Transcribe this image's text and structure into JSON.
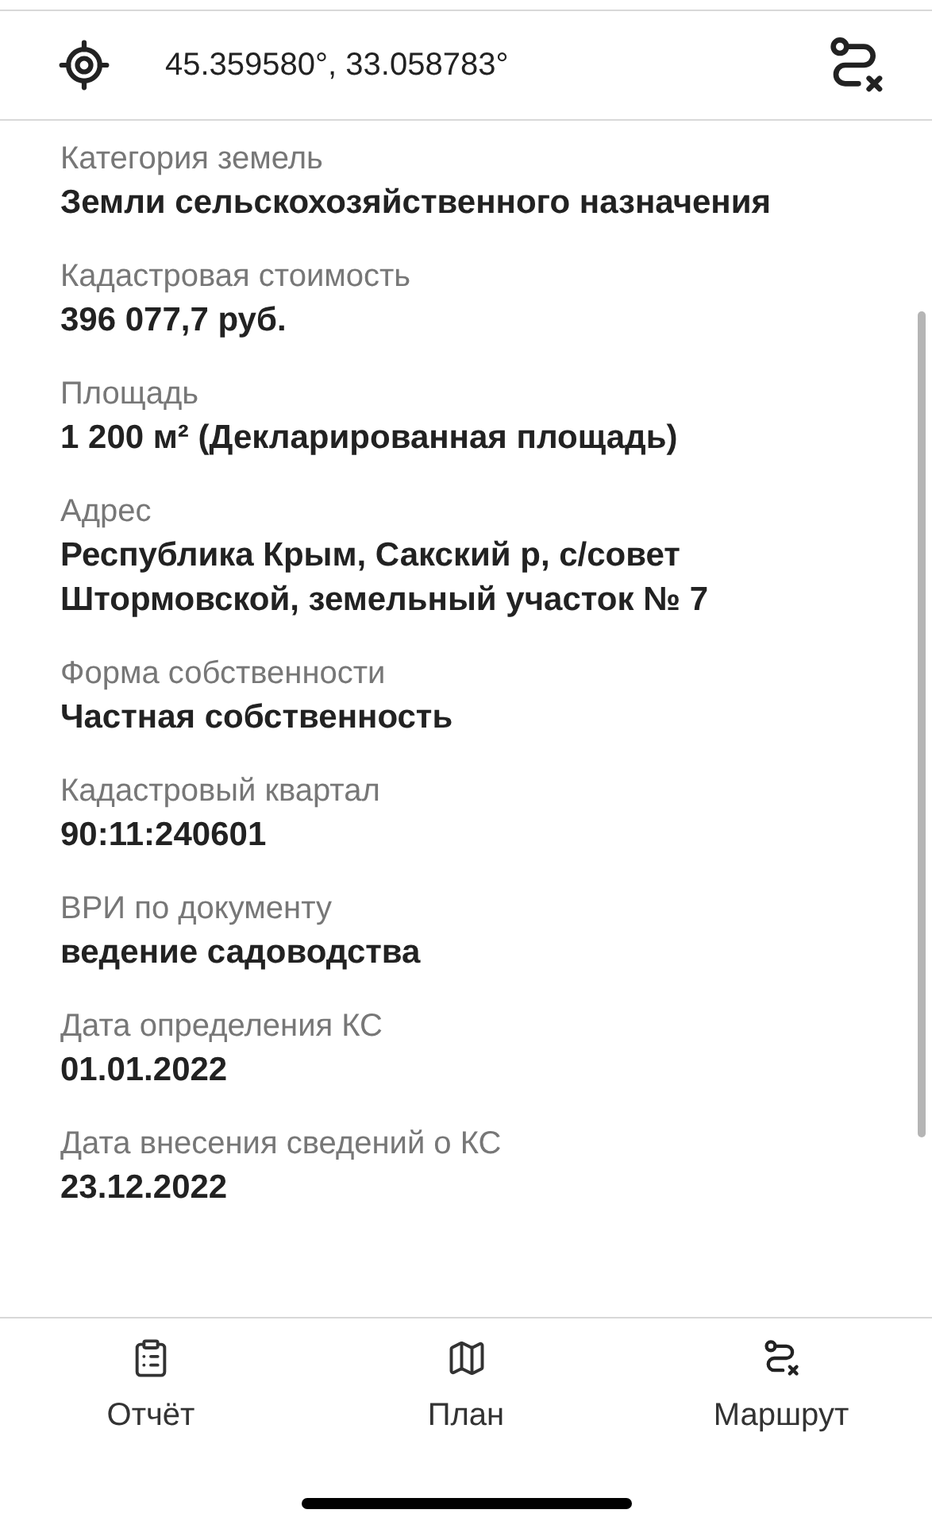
{
  "header": {
    "coordinates": "45.359580°, 33.058783°"
  },
  "fields": [
    {
      "label": "Категория земель",
      "value": "Земли сельскохозяйственного назначения"
    },
    {
      "label": "Кадастровая стоимость",
      "value": "396 077,7 руб."
    },
    {
      "label": "Площадь",
      "value": "1 200 м² (Декларированная площадь)"
    },
    {
      "label": "Адрес",
      "value": "Республика Крым, Сакский р, с/совет Штормовской, земельный участок № 7"
    },
    {
      "label": "Форма собственности",
      "value": "Частная собственность"
    },
    {
      "label": "Кадастровый квартал",
      "value": "90:11:240601"
    },
    {
      "label": "ВРИ по документу",
      "value": "ведение садоводства"
    },
    {
      "label": "Дата определения КС",
      "value": "01.01.2022"
    },
    {
      "label": "Дата внесения сведений о КС",
      "value": "23.12.2022"
    }
  ],
  "tab_bar": [
    {
      "kind": "report",
      "label": "Отчёт"
    },
    {
      "kind": "plan",
      "label": "План"
    },
    {
      "kind": "route",
      "label": "Маршрут"
    }
  ]
}
